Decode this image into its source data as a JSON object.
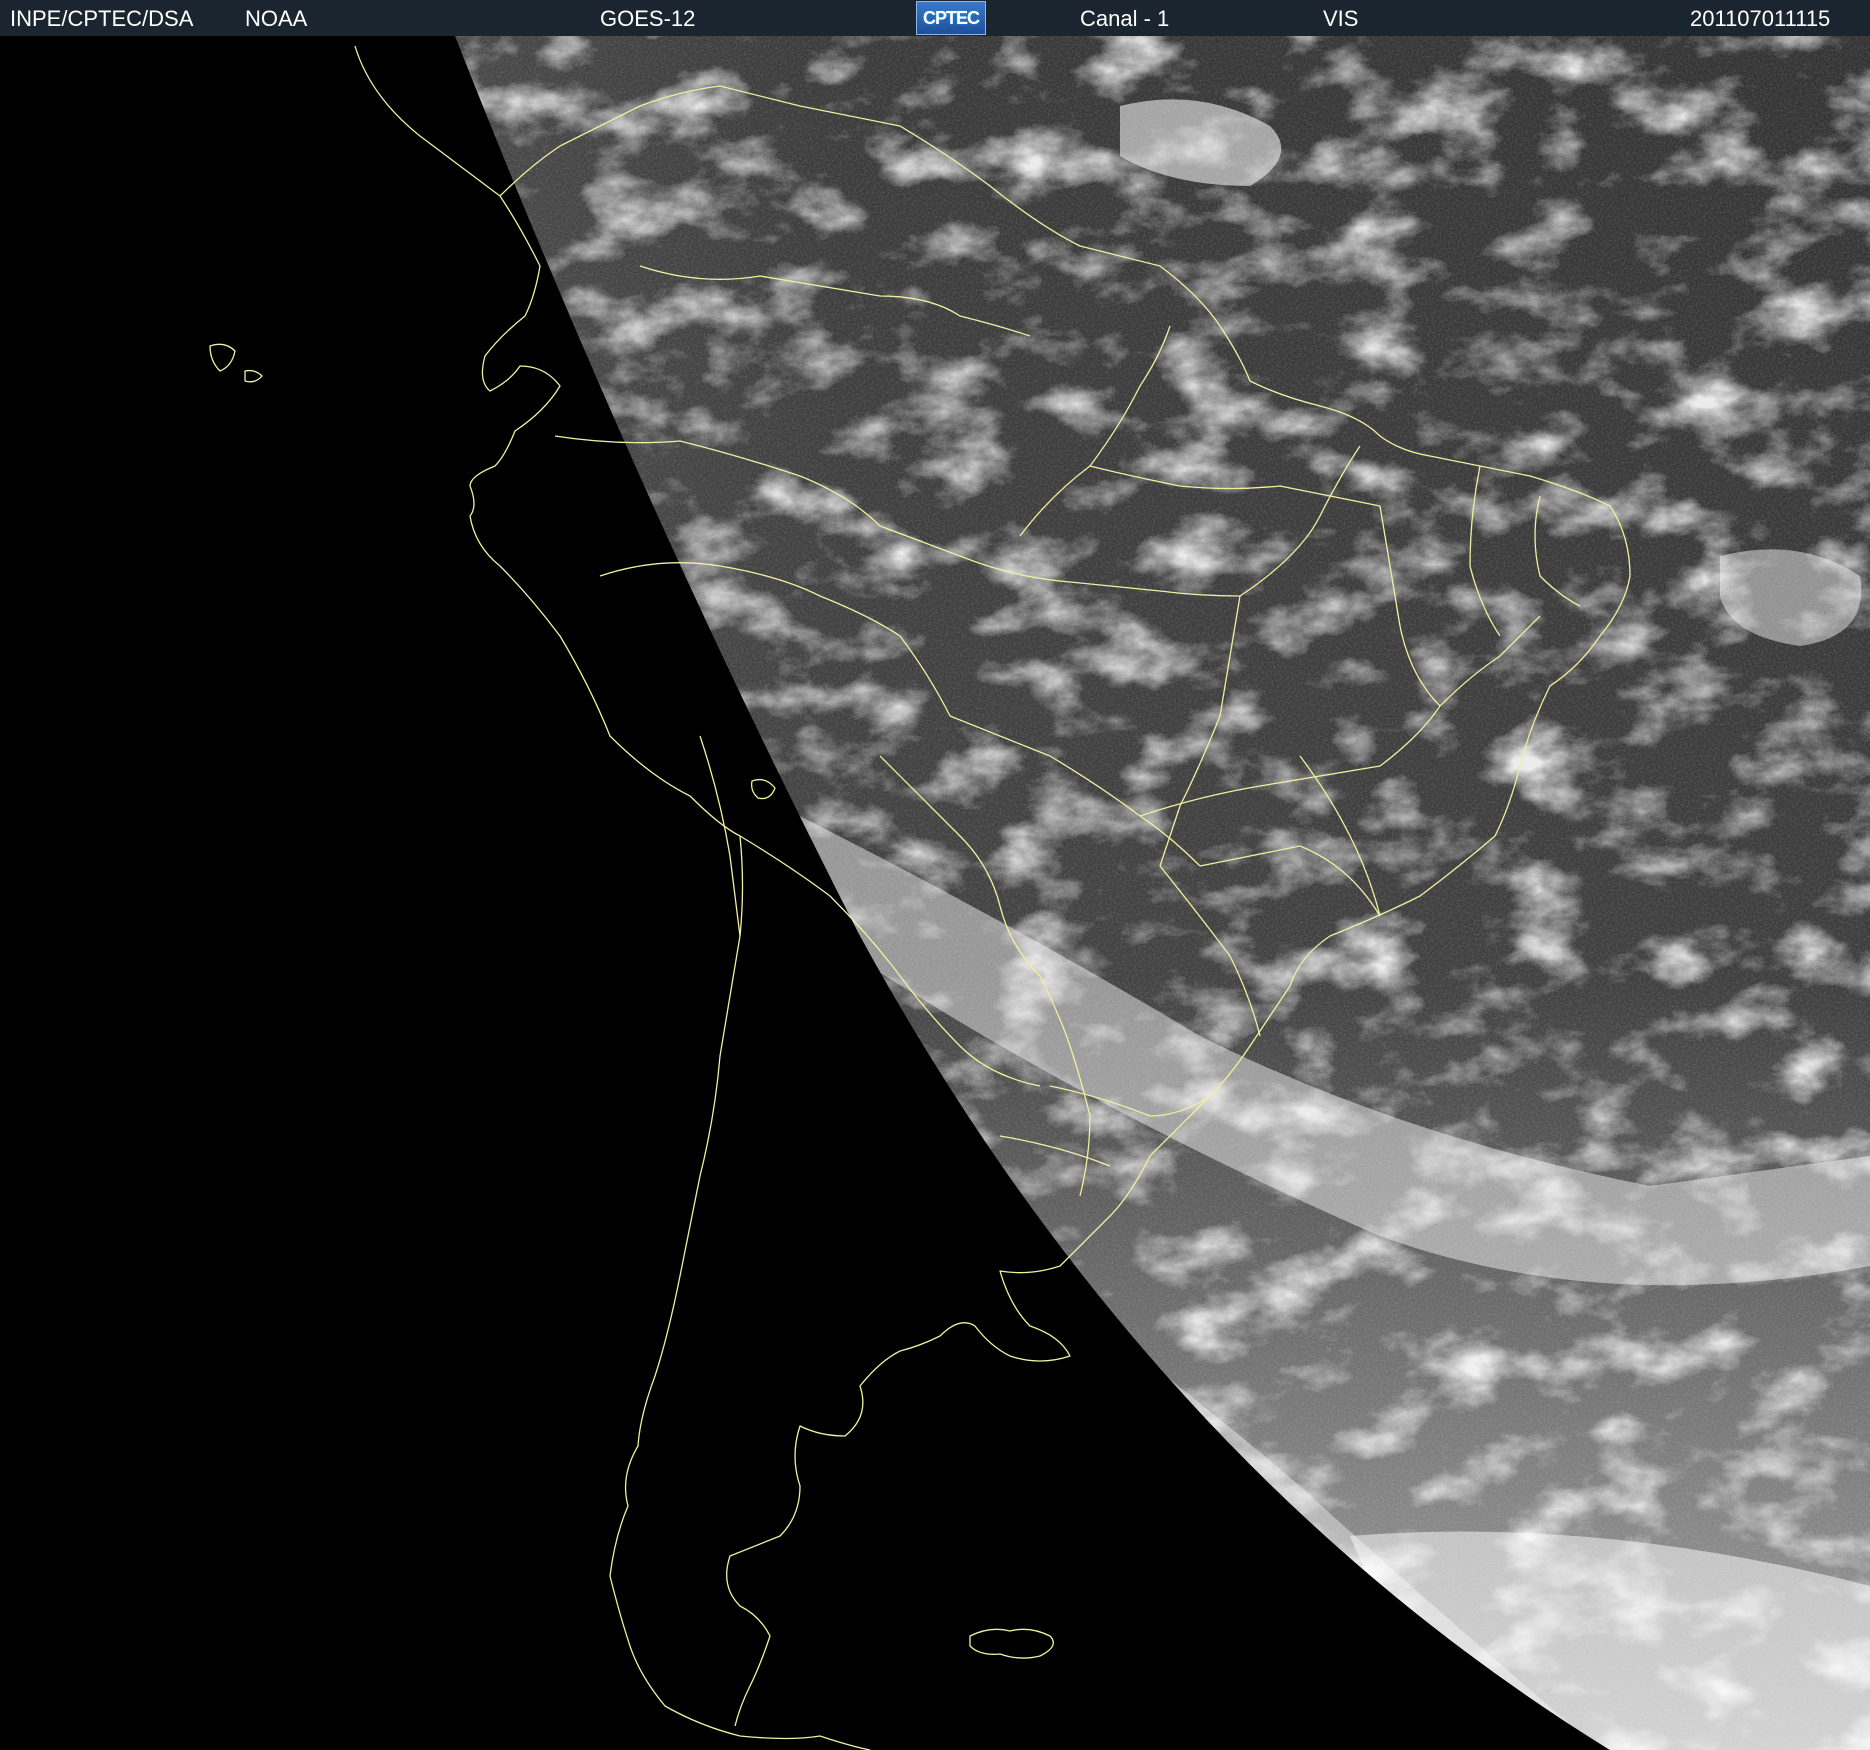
{
  "header": {
    "source": "INPE/CPTEC/DSA",
    "agency": "NOAA",
    "satellite": "GOES-12",
    "logo_text": "CPTEC",
    "channel": "Canal - 1",
    "band": "VIS",
    "timestamp": "201107011115"
  },
  "colors": {
    "header_bg": "#1a2530",
    "space": "#000000",
    "boundary_lines": "#f0f0a0",
    "ocean_gray": "#3c3c3c",
    "cloud_white": "#e8e8e8"
  },
  "map": {
    "type": "satellite-visible-image",
    "region": "South America"
  }
}
